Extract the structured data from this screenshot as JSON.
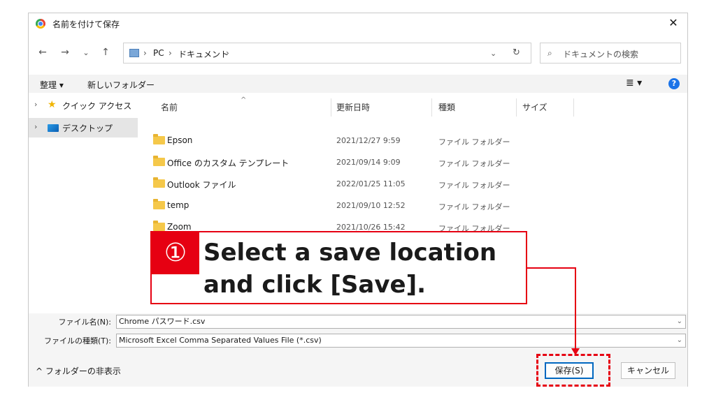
{
  "window": {
    "title": "名前を付けて保存",
    "close_glyph": "✕"
  },
  "nav": {
    "back": "←",
    "forward": "→",
    "recent": "⌄",
    "up": "↑",
    "breadcrumb": [
      "PC",
      "ドキュメント"
    ],
    "crumb_sep": "›",
    "dropdown": "⌄",
    "refresh": "↻",
    "search_placeholder": "ドキュメントの検索"
  },
  "toolbar": {
    "organize": "整理 ▾",
    "new_folder": "新しいフォルダー",
    "view": "≣ ▾",
    "help": "?"
  },
  "sidebar": {
    "items": [
      {
        "label": "クイック アクセス",
        "arrow": "›"
      },
      {
        "label": "デスクトップ",
        "arrow": "›"
      }
    ]
  },
  "columns": {
    "name": "名前",
    "date": "更新日時",
    "type": "種類",
    "size": "サイズ",
    "sort_caret": "^"
  },
  "files": [
    {
      "name": "Epson",
      "date": "2021/12/27 9:59",
      "type": "ファイル フォルダー"
    },
    {
      "name": "Office のカスタム テンプレート",
      "date": "2021/09/14 9:09",
      "type": "ファイル フォルダー"
    },
    {
      "name": "Outlook ファイル",
      "date": "2022/01/25 11:05",
      "type": "ファイル フォルダー"
    },
    {
      "name": "temp",
      "date": "2021/09/10 12:52",
      "type": "ファイル フォルダー"
    },
    {
      "name": "Zoom",
      "date": "2021/10/26 15:42",
      "type": "ファイル フォルダー"
    }
  ],
  "form": {
    "filename_label": "ファイル名(N):",
    "filename_value": "Chrome パスワード.csv",
    "filetype_label": "ファイルの種類(T):",
    "filetype_value": "Microsoft Excel Comma Separated Values File (*.csv)",
    "chevron": "⌄"
  },
  "footer": {
    "hide_folders": "^ フォルダーの非表示",
    "save": "保存(S)",
    "cancel": "キャンセル"
  },
  "callout": {
    "number": "①",
    "line1": "Select a save location",
    "line2": "and click [Save]."
  },
  "colors": {
    "accent_red": "#e60012",
    "primary_blue": "#0067c0",
    "folder_yellow": "#f5c84a"
  }
}
